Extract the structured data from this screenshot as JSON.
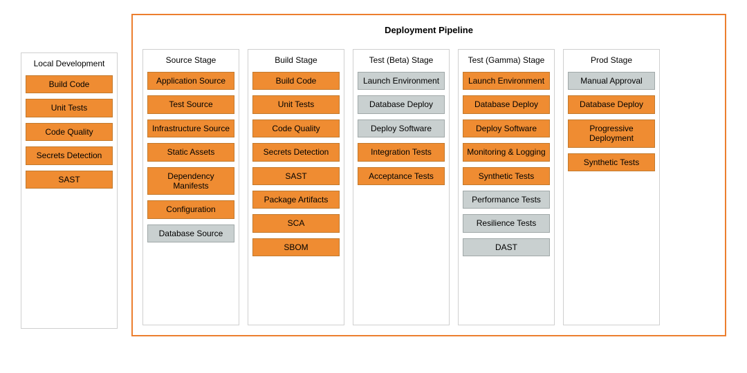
{
  "colors": {
    "orange": "#ef8c32",
    "grey": "#c9d0d0",
    "frame": "#ec7e2e"
  },
  "local": {
    "title": "Local Development",
    "steps": [
      {
        "label": "Build Code",
        "kind": "orange"
      },
      {
        "label": "Unit Tests",
        "kind": "orange"
      },
      {
        "label": "Code Quality",
        "kind": "orange"
      },
      {
        "label": "Secrets Detection",
        "kind": "orange"
      },
      {
        "label": "SAST",
        "kind": "orange"
      }
    ]
  },
  "pipeline": {
    "title": "Deployment Pipeline",
    "stages": [
      {
        "title": "Source Stage",
        "steps": [
          {
            "label": "Application Source",
            "kind": "orange"
          },
          {
            "label": "Test Source",
            "kind": "orange"
          },
          {
            "label": "Infrastructure Source",
            "kind": "orange"
          },
          {
            "label": "Static Assets",
            "kind": "orange"
          },
          {
            "label": "Dependency Manifests",
            "kind": "orange"
          },
          {
            "label": "Configuration",
            "kind": "orange"
          },
          {
            "label": "Database Source",
            "kind": "grey"
          }
        ]
      },
      {
        "title": "Build Stage",
        "steps": [
          {
            "label": "Build Code",
            "kind": "orange"
          },
          {
            "label": "Unit Tests",
            "kind": "orange"
          },
          {
            "label": "Code Quality",
            "kind": "orange"
          },
          {
            "label": "Secrets Detection",
            "kind": "orange"
          },
          {
            "label": "SAST",
            "kind": "orange"
          },
          {
            "label": "Package Artifacts",
            "kind": "orange"
          },
          {
            "label": "SCA",
            "kind": "orange"
          },
          {
            "label": "SBOM",
            "kind": "orange"
          }
        ]
      },
      {
        "title": "Test (Beta) Stage",
        "steps": [
          {
            "label": "Launch Environment",
            "kind": "grey"
          },
          {
            "label": "Database Deploy",
            "kind": "grey"
          },
          {
            "label": "Deploy Software",
            "kind": "grey"
          },
          {
            "label": "Integration Tests",
            "kind": "orange"
          },
          {
            "label": "Acceptance Tests",
            "kind": "orange"
          }
        ]
      },
      {
        "title": "Test (Gamma) Stage",
        "steps": [
          {
            "label": "Launch Environment",
            "kind": "orange"
          },
          {
            "label": "Database Deploy",
            "kind": "orange"
          },
          {
            "label": "Deploy Software",
            "kind": "orange"
          },
          {
            "label": "Monitoring & Logging",
            "kind": "orange"
          },
          {
            "label": "Synthetic Tests",
            "kind": "orange"
          },
          {
            "label": "Performance Tests",
            "kind": "grey"
          },
          {
            "label": "Resilience Tests",
            "kind": "grey"
          },
          {
            "label": "DAST",
            "kind": "grey"
          }
        ]
      },
      {
        "title": "Prod Stage",
        "steps": [
          {
            "label": "Manual Approval",
            "kind": "grey"
          },
          {
            "label": "Database Deploy",
            "kind": "orange"
          },
          {
            "label": "Progressive Deployment",
            "kind": "orange"
          },
          {
            "label": "Synthetic Tests",
            "kind": "orange"
          }
        ]
      }
    ]
  }
}
